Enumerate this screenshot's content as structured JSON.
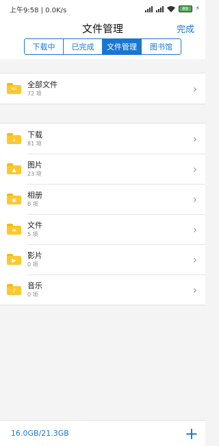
{
  "status": {
    "time_speed": "上午9:58 | 0.0K/s",
    "battery": "89"
  },
  "header": {
    "title": "文件管理",
    "done": "完成"
  },
  "tabs": [
    {
      "label": "下载中",
      "active": false
    },
    {
      "label": "已完成",
      "active": false
    },
    {
      "label": "文件管理",
      "active": true
    },
    {
      "label": "图书馆",
      "active": false
    }
  ],
  "all_files": {
    "name": "全部文件",
    "count": "72 项",
    "icon": "all-folder-icon",
    "badge": "ALL"
  },
  "folders": [
    {
      "name": "下载",
      "count": "81 项",
      "icon": "download-folder-icon",
      "glyph": "↓"
    },
    {
      "name": "图片",
      "count": "23 项",
      "icon": "image-folder-icon",
      "glyph": "▲"
    },
    {
      "name": "相册",
      "count": "6 项",
      "icon": "album-folder-icon",
      "glyph": "◉"
    },
    {
      "name": "文件",
      "count": "5 项",
      "icon": "document-folder-icon",
      "glyph": "≡"
    },
    {
      "name": "影片",
      "count": "0 项",
      "icon": "video-folder-icon",
      "glyph": "▶"
    },
    {
      "name": "音乐",
      "count": "0 项",
      "icon": "music-folder-icon",
      "glyph": "♪"
    }
  ],
  "footer": {
    "storage": "16.0GB/21.3GB"
  },
  "colors": {
    "accent": "#1976d2",
    "folder": "#fdc82f"
  }
}
